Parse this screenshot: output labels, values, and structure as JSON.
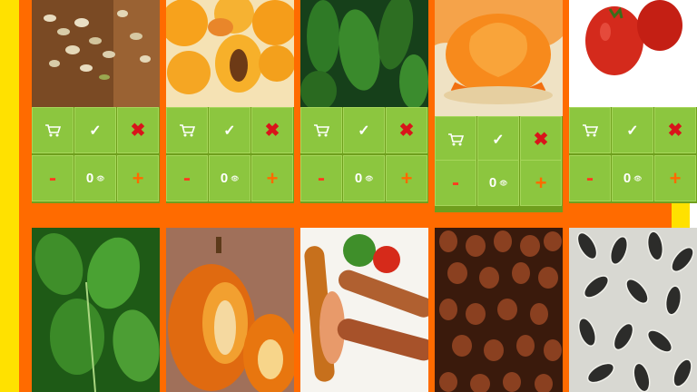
{
  "products_top": [
    {
      "name": "pistachios",
      "quantity": "0",
      "minus": "-",
      "plus": "+"
    },
    {
      "name": "apricots",
      "quantity": "0",
      "minus": "-",
      "plus": "+"
    },
    {
      "name": "cucumbers",
      "quantity": "0",
      "minus": "-",
      "plus": "+"
    },
    {
      "name": "tangerine",
      "quantity": "0",
      "minus": "-",
      "plus": "+"
    },
    {
      "name": "tomatoes",
      "quantity": "0",
      "minus": "-",
      "plus": "+"
    }
  ],
  "products_bottom": [
    {
      "name": "spinach"
    },
    {
      "name": "pumpkin"
    },
    {
      "name": "sausages"
    },
    {
      "name": "hazelnuts"
    },
    {
      "name": "sunflower-seeds"
    }
  ],
  "icons": {
    "cart": "cart-icon",
    "confirm": "check-icon",
    "remove": "x-icon",
    "view": "eye-icon"
  },
  "colors": {
    "background": "#ff6b00",
    "strip": "#ffe100",
    "button": "#8cc63f",
    "remove": "#d9141b",
    "minus": "#ff3b1f",
    "plus": "#ff6a00"
  }
}
